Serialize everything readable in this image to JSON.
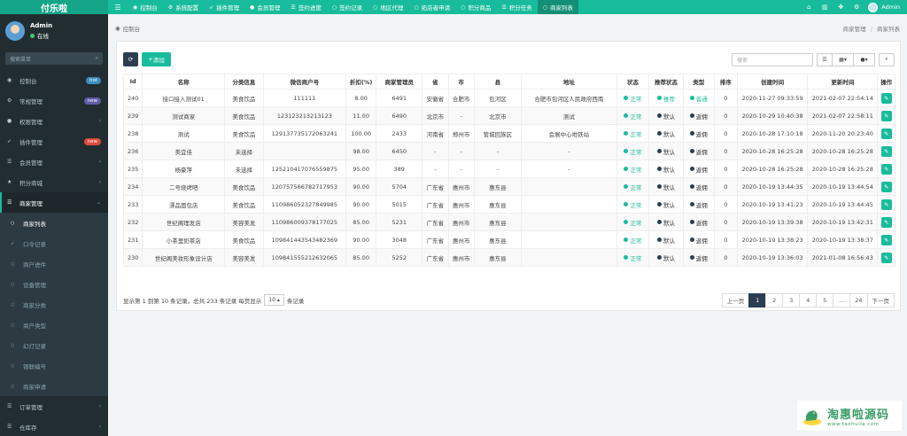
{
  "brand": "付乐啦",
  "topnav": [
    {
      "icon": "dashboard-icon",
      "glyph": "◉",
      "label": "控制台",
      "active": false
    },
    {
      "icon": "gear-icon",
      "glyph": "⚙",
      "label": "系统配置",
      "active": false
    },
    {
      "icon": "rocket-icon",
      "glyph": "➶",
      "label": "插件管理",
      "active": false
    },
    {
      "icon": "user-icon",
      "glyph": "●",
      "label": "会员管理",
      "active": false
    },
    {
      "icon": "list-icon",
      "glyph": "☰",
      "label": "签约进度",
      "active": false
    },
    {
      "icon": "circle-icon",
      "glyph": "○",
      "label": "签约记录",
      "active": false
    },
    {
      "icon": "circle-icon",
      "glyph": "○",
      "label": "地区代理",
      "active": false
    },
    {
      "icon": "circle-icon",
      "glyph": "○",
      "label": "拓店者申请",
      "active": false
    },
    {
      "icon": "circle-icon",
      "glyph": "○",
      "label": "积分商品",
      "active": false
    },
    {
      "icon": "list-icon",
      "glyph": "☰",
      "label": "积分任务",
      "active": false
    },
    {
      "icon": "circle-icon",
      "glyph": "○",
      "label": "商家列表",
      "active": true
    }
  ],
  "top_right": {
    "admin_name": "Admin"
  },
  "user": {
    "name": "Admin",
    "status": "在线"
  },
  "side_search_placeholder": "搜索菜单",
  "sidebar": [
    {
      "icon": "dashboard-icon",
      "glyph": "◉",
      "label": "控制台",
      "badge": "hot",
      "badge_color": "#3c8dbc",
      "type": "top"
    },
    {
      "icon": "gear-icon",
      "glyph": "⚙",
      "label": "常规管理",
      "badge": "new",
      "badge_color": "#605ca8",
      "type": "top"
    },
    {
      "icon": "group-icon",
      "glyph": "●",
      "label": "权限管理",
      "arrow": "‹",
      "type": "top"
    },
    {
      "icon": "rocket-icon",
      "glyph": "➶",
      "label": "插件管理",
      "badge": "new",
      "badge_color": "#dd4b39",
      "type": "top"
    },
    {
      "icon": "list-icon",
      "glyph": "☰",
      "label": "会员管理",
      "arrow": "‹",
      "type": "top"
    },
    {
      "icon": "star-icon",
      "glyph": "★",
      "label": "积分商城",
      "arrow": "‹",
      "type": "top"
    },
    {
      "icon": "list-icon",
      "glyph": "☰",
      "label": "商家管理",
      "arrow": "⌄",
      "type": "open"
    },
    {
      "icon": "circle-icon",
      "glyph": "○",
      "label": "商家列表",
      "type": "sub-active"
    },
    {
      "icon": "rocket-icon",
      "glyph": "➶",
      "label": "口令记录",
      "type": "sub"
    },
    {
      "icon": "circle-icon",
      "glyph": "○",
      "label": "商户进件",
      "type": "sub"
    },
    {
      "icon": "circle-icon",
      "glyph": "○",
      "label": "设备管理",
      "type": "sub"
    },
    {
      "icon": "circle-icon",
      "glyph": "○",
      "label": "商家分类",
      "type": "sub"
    },
    {
      "icon": "circle-icon",
      "glyph": "○",
      "label": "商户类型",
      "type": "sub"
    },
    {
      "icon": "circle-icon",
      "glyph": "○",
      "label": "幻灯记录",
      "type": "sub"
    },
    {
      "icon": "circle-icon",
      "glyph": "○",
      "label": "银联编号",
      "type": "sub"
    },
    {
      "icon": "circle-icon",
      "glyph": "○",
      "label": "商家申请",
      "type": "sub"
    },
    {
      "icon": "list-icon",
      "glyph": "☰",
      "label": "订单管理",
      "arrow": "‹",
      "type": "top"
    },
    {
      "icon": "list-icon",
      "glyph": "☰",
      "label": "仓库存",
      "arrow": "‹",
      "type": "top"
    }
  ],
  "breadcrumb": {
    "home": "控制台",
    "parent": "商家管理",
    "current": "商家列表",
    "separator": "/"
  },
  "toolbar": {
    "add_label": "添加",
    "search_placeholder": "搜索"
  },
  "table": {
    "headers": [
      "Id",
      "名称",
      "分类信息",
      "微信商户号",
      "折扣(%)",
      "商家管理员",
      "省",
      "市",
      "县",
      "地址",
      "状态",
      "推荐状态",
      "类型",
      "排序",
      "创建时间",
      "更新时间",
      "操作"
    ],
    "rows": [
      {
        "id": "240",
        "name": "接口接入测试01",
        "category": "美食饮品",
        "wx": "111111",
        "discount": "8.00",
        "admin": "6491",
        "prov": "安徽省",
        "city": "合肥市",
        "county": "包河区",
        "addr": "合肥市包河区人民政府西南",
        "status": "正常",
        "status_c": "green",
        "rec": "推荐",
        "rec_c": "green",
        "type": "普通",
        "type_c": "green",
        "sort": "0",
        "created": "2020-11-27 09:33:59",
        "updated": "2021-02-07 22:54:14"
      },
      {
        "id": "239",
        "name": "测试商家",
        "category": "美食饮品",
        "wx": "123123213213123",
        "discount": "11.00",
        "admin": "6490",
        "prov": "北京市",
        "city": "-",
        "county": "北京市",
        "addr": "测试",
        "status": "正常",
        "status_c": "green",
        "rec": "默认",
        "rec_c": "dark",
        "type": "返佣",
        "type_c": "dark",
        "sort": "0",
        "created": "2020-10-29 10:40:38",
        "updated": "2021-02-07 22:58:11"
      },
      {
        "id": "238",
        "name": "测试",
        "category": "美食饮品",
        "wx": "129137735172063241",
        "discount": "100.00",
        "admin": "2433",
        "prov": "河南省",
        "city": "郑州市",
        "county": "管城回族区",
        "addr": "会展中心地铁站",
        "status": "正常",
        "status_c": "green",
        "rec": "默认",
        "rec_c": "dark",
        "type": "返佣",
        "type_c": "dark",
        "sort": "0",
        "created": "2020-10-28 17:10:18",
        "updated": "2020-11-20 20:23:40"
      },
      {
        "id": "236",
        "name": "美宜佳",
        "category": "未选择",
        "wx": "",
        "discount": "98.00",
        "admin": "6450",
        "prov": "-",
        "city": "-",
        "county": "-",
        "addr": "-",
        "status": "正常",
        "status_c": "green",
        "rec": "默认",
        "rec_c": "dark",
        "type": "返佣",
        "type_c": "dark",
        "sort": "0",
        "created": "2020-10-28 16:25:28",
        "updated": "2020-10-28 16:25:28"
      },
      {
        "id": "235",
        "name": "杨豪萍",
        "category": "未选择",
        "wx": "125210417076559875",
        "discount": "95.00",
        "admin": "389",
        "prov": "-",
        "city": "-",
        "county": "-",
        "addr": "-",
        "status": "正常",
        "status_c": "green",
        "rec": "默认",
        "rec_c": "dark",
        "type": "返佣",
        "type_c": "dark",
        "sort": "0",
        "created": "2020-10-28 16:25:28",
        "updated": "2020-10-28 16:25:28"
      },
      {
        "id": "234",
        "name": "二号烧烤吧",
        "category": "美食饮品",
        "wx": "120757566782717953",
        "discount": "90.00",
        "admin": "5704",
        "prov": "广东省",
        "city": "惠州市",
        "county": "惠东县",
        "addr": "",
        "status": "正常",
        "status_c": "green",
        "rec": "默认",
        "rec_c": "dark",
        "type": "返佣",
        "type_c": "dark",
        "sort": "0",
        "created": "2020-10-19 13:44:35",
        "updated": "2020-10-19 13:44:54"
      },
      {
        "id": "233",
        "name": "漂品面包店",
        "category": "美食饮品",
        "wx": "110986052327849985",
        "discount": "90.00",
        "admin": "5015",
        "prov": "广东省",
        "city": "惠州市",
        "county": "惠东县",
        "addr": "",
        "status": "正常",
        "status_c": "green",
        "rec": "默认",
        "rec_c": "dark",
        "type": "返佣",
        "type_c": "dark",
        "sort": "0",
        "created": "2020-10-19 13:41:23",
        "updated": "2020-10-19 13:44:45"
      },
      {
        "id": "232",
        "name": "世纪阁理发店",
        "category": "美容美发",
        "wx": "110986009378177025",
        "discount": "85.00",
        "admin": "5231",
        "prov": "广东省",
        "city": "惠州市",
        "county": "惠东县",
        "addr": "",
        "status": "正常",
        "status_c": "green",
        "rec": "默认",
        "rec_c": "dark",
        "type": "返佣",
        "type_c": "dark",
        "sort": "0",
        "created": "2020-10-19 13:39:38",
        "updated": "2020-10-19 13:42:31"
      },
      {
        "id": "231",
        "name": "小茶里奶茶店",
        "category": "美食饮品",
        "wx": "109841443543482369",
        "discount": "90.00",
        "admin": "3048",
        "prov": "广东省",
        "city": "惠州市",
        "county": "惠东县",
        "addr": "",
        "status": "正常",
        "status_c": "green",
        "rec": "默认",
        "rec_c": "dark",
        "type": "返佣",
        "type_c": "dark",
        "sort": "0",
        "created": "2020-10-19 13:38:23",
        "updated": "2020-10-19 13:38:37"
      },
      {
        "id": "230",
        "name": "世纪阁美妆形象设计店",
        "category": "美容美发",
        "wx": "109841555212632065",
        "discount": "85.00",
        "admin": "5252",
        "prov": "广东省",
        "city": "惠州市",
        "county": "惠东县",
        "addr": "",
        "status": "正常",
        "status_c": "green",
        "rec": "默认",
        "rec_c": "dark",
        "type": "返佣",
        "type_c": "dark",
        "sort": "0",
        "created": "2020-10-19 13:36:03",
        "updated": "2021-01-08 16:56:43"
      }
    ]
  },
  "footer": {
    "summary": "显示第 1 到第 10 条记录，总共 233 条记录 每页显示",
    "page_size": "10",
    "suffix": "条记录"
  },
  "pager": [
    "上一页",
    "1",
    "2",
    "3",
    "4",
    "5",
    "...",
    "24",
    "下一页"
  ],
  "pager_active": "1",
  "watermark": {
    "main": "淘惠啦源码",
    "sub": "www.taohuila.com"
  },
  "colors": {
    "accent": "#18bc9c",
    "sidebar": "#222d32",
    "dark": "#2c3e50"
  }
}
